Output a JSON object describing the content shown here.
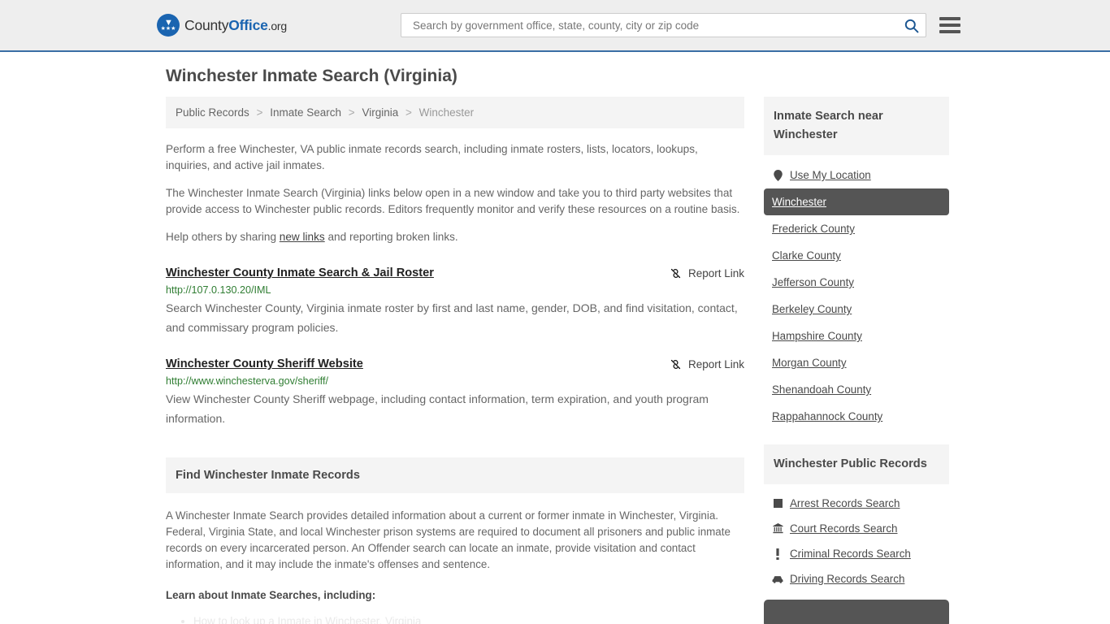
{
  "header": {
    "logo": {
      "part1": "County",
      "part2": "Office",
      "part3": ".org",
      "icon": "eagle-seal-icon"
    },
    "search": {
      "placeholder": "Search by government office, state, county, city or zip code",
      "value": "",
      "icon": "search-icon"
    },
    "menu_icon": "hamburger-menu-icon",
    "accent_color": "#3a6ea5",
    "background_color": "#eeeeee"
  },
  "page": {
    "title": "Winchester Inmate Search (Virginia)"
  },
  "breadcrumb": {
    "items": [
      {
        "label": "Public Records",
        "current": false
      },
      {
        "label": "Inmate Search",
        "current": false
      },
      {
        "label": "Virginia",
        "current": false
      },
      {
        "label": "Winchester",
        "current": true
      }
    ],
    "separator": ">"
  },
  "intro": {
    "paragraph1": "Perform a free Winchester, VA public inmate records search, including inmate rosters, lists, locators, lookups, inquiries, and active jail inmates.",
    "paragraph2": "The Winchester Inmate Search (Virginia) links below open in a new window and take you to third party websites that provide access to Winchester public records. Editors frequently monitor and verify these resources on a routine basis.",
    "paragraph3_before": "Help others by sharing ",
    "paragraph3_link": "new links",
    "paragraph3_after": " and reporting broken links."
  },
  "results": [
    {
      "title": "Winchester County Inmate Search & Jail Roster",
      "url": "http://107.0.130.20/IML",
      "description": "Search Winchester County, Virginia inmate roster by first and last name, gender, DOB, and find visitation, contact, and commissary program policies.",
      "report_label": "Report Link",
      "report_icon": "unlink-icon"
    },
    {
      "title": "Winchester County Sheriff Website",
      "url": "http://www.winchesterva.gov/sheriff/",
      "description": "View Winchester County Sheriff webpage, including contact information, term expiration, and youth program information.",
      "report_label": "Report Link",
      "report_icon": "unlink-icon"
    }
  ],
  "find_section": {
    "heading": "Find Winchester Inmate Records",
    "body": "A Winchester Inmate Search provides detailed information about a current or former inmate in Winchester, Virginia. Federal, Virginia State, and local Winchester prison systems are required to document all prisoners and public inmate records on every incarcerated person. An Offender search can locate an inmate, provide visitation and contact information, and it may include the inmate's offenses and sentence.",
    "subheading": "Learn about Inmate Searches, including:",
    "list": [
      "How to look up a Inmate in Winchester, Virginia"
    ]
  },
  "sidebar": {
    "near_panel": {
      "heading": "Inmate Search near Winchester",
      "items": [
        {
          "label": "Use My Location",
          "icon": "map-pin-icon",
          "active": false
        },
        {
          "label": "Winchester",
          "icon": "",
          "active": true
        },
        {
          "label": "Frederick County",
          "icon": "",
          "active": false
        },
        {
          "label": "Clarke County",
          "icon": "",
          "active": false
        },
        {
          "label": "Jefferson County",
          "icon": "",
          "active": false
        },
        {
          "label": "Berkeley County",
          "icon": "",
          "active": false
        },
        {
          "label": "Hampshire County",
          "icon": "",
          "active": false
        },
        {
          "label": "Morgan County",
          "icon": "",
          "active": false
        },
        {
          "label": "Shenandoah County",
          "icon": "",
          "active": false
        },
        {
          "label": "Rappahannock County",
          "icon": "",
          "active": false
        }
      ]
    },
    "records_panel": {
      "heading": "Winchester Public Records",
      "items": [
        {
          "label": "Arrest Records Search",
          "icon": "square-badge-icon",
          "glyph": "■"
        },
        {
          "label": "Court Records Search",
          "icon": "courthouse-icon",
          "glyph": "🏛"
        },
        {
          "label": "Criminal Records Search",
          "icon": "exclamation-icon",
          "glyph": "❗"
        },
        {
          "label": "Driving Records Search",
          "icon": "car-icon",
          "glyph": "🚗"
        }
      ]
    },
    "active_color": "#555555"
  }
}
